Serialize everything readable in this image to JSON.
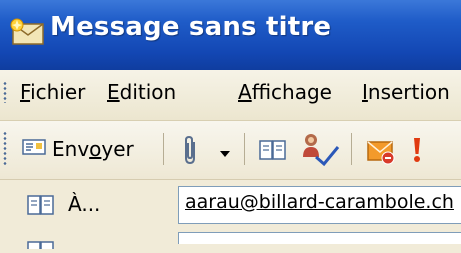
{
  "window": {
    "title": "Message sans titre",
    "icon": "new-message-icon"
  },
  "menubar": {
    "items": [
      {
        "first": "F",
        "rest": "ichier"
      },
      {
        "first": "E",
        "rest": "dition"
      },
      {
        "first": "A",
        "rest": "ffichage"
      },
      {
        "first": "I",
        "rest": "nsertion"
      }
    ]
  },
  "toolbar": {
    "send": {
      "before": "Env",
      "underlined": "o",
      "after": "yer",
      "icon": "send-envelope-icon"
    },
    "icons": [
      "paperclip-icon",
      "dropdown-arrow-icon",
      "address-book-icon",
      "check-names-icon",
      "options-envelope-icon",
      "importance-high-icon"
    ]
  },
  "form": {
    "to_label": "À...",
    "to_icon": "address-book-icon",
    "to_value": "aarau@billard-carambole.ch"
  },
  "colors": {
    "title_bar": "#1f5cc8",
    "toolbar_bg": "#efe9d6",
    "accent_orange": "#f39a2b",
    "importance_red": "#e03a10"
  }
}
